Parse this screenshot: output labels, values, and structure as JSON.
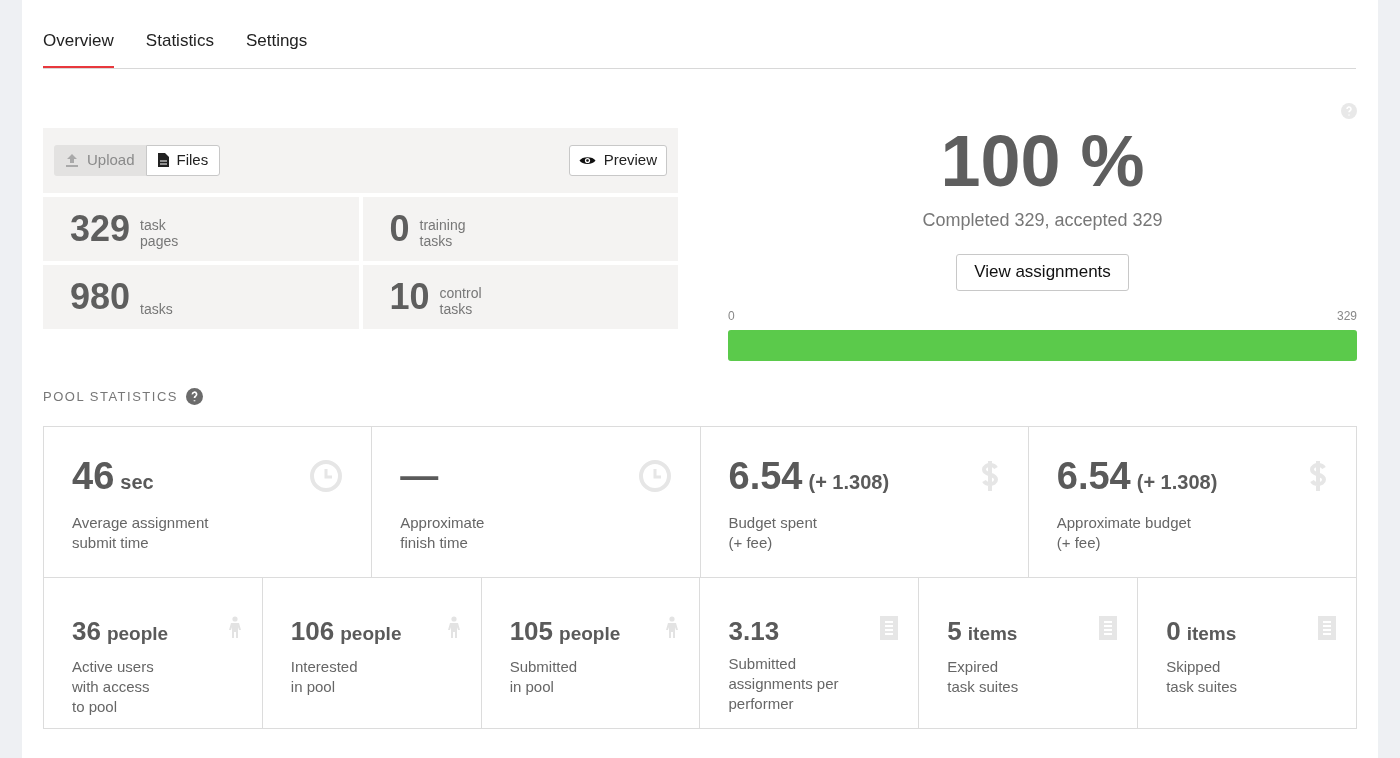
{
  "tabs": [
    {
      "label": "Overview",
      "selected": true
    },
    {
      "label": "Statistics",
      "selected": false
    },
    {
      "label": "Settings",
      "selected": false
    }
  ],
  "toolbar": {
    "upload": {
      "label": "Upload",
      "disabled": true
    },
    "files": {
      "label": "Files"
    },
    "preview": {
      "label": "Preview"
    }
  },
  "task_counts": [
    {
      "value": "329",
      "label": "task\npages"
    },
    {
      "value": "0",
      "label": "training\ntasks"
    },
    {
      "value": "980",
      "label": "tasks"
    },
    {
      "value": "10",
      "label": "control\ntasks"
    }
  ],
  "progress": {
    "percent": "100 %",
    "summary": "Completed 329, accepted 329",
    "button": "View assignments",
    "min": "0",
    "max": "329",
    "level": 1
  },
  "pool_statistics": {
    "title": "POOL STATISTICS",
    "top": [
      {
        "value": "46",
        "unit": "sec",
        "label": "Average assignment\nsubmit time",
        "kind": "time"
      },
      {
        "value": "—",
        "label": "Approximate\nfinish time",
        "kind": "time"
      },
      {
        "value": "6.54",
        "unit": "(+ 1.308)",
        "label": "Budget spent\n(+ fee)",
        "kind": "money"
      },
      {
        "value": "6.54",
        "unit": "(+ 1.308)",
        "label": "Approximate budget\n(+ fee)",
        "kind": "money"
      }
    ],
    "bottom": [
      {
        "value": "36",
        "unit": "people",
        "label": "Active users\nwith access\nto pool",
        "kind": "people"
      },
      {
        "value": "106",
        "unit": "people",
        "label": "Interested\nin pool",
        "kind": "people"
      },
      {
        "value": "105",
        "unit": "people",
        "label": "Submitted\nin pool",
        "kind": "people"
      },
      {
        "value": "3.13",
        "label": "Submitted\nassignments per\nperformer",
        "kind": "items"
      },
      {
        "value": "5",
        "unit": "items",
        "label": "Expired\ntask suites",
        "kind": "items"
      },
      {
        "value": "0",
        "unit": "items",
        "label": "Skipped\ntask suites",
        "kind": "items"
      }
    ]
  }
}
